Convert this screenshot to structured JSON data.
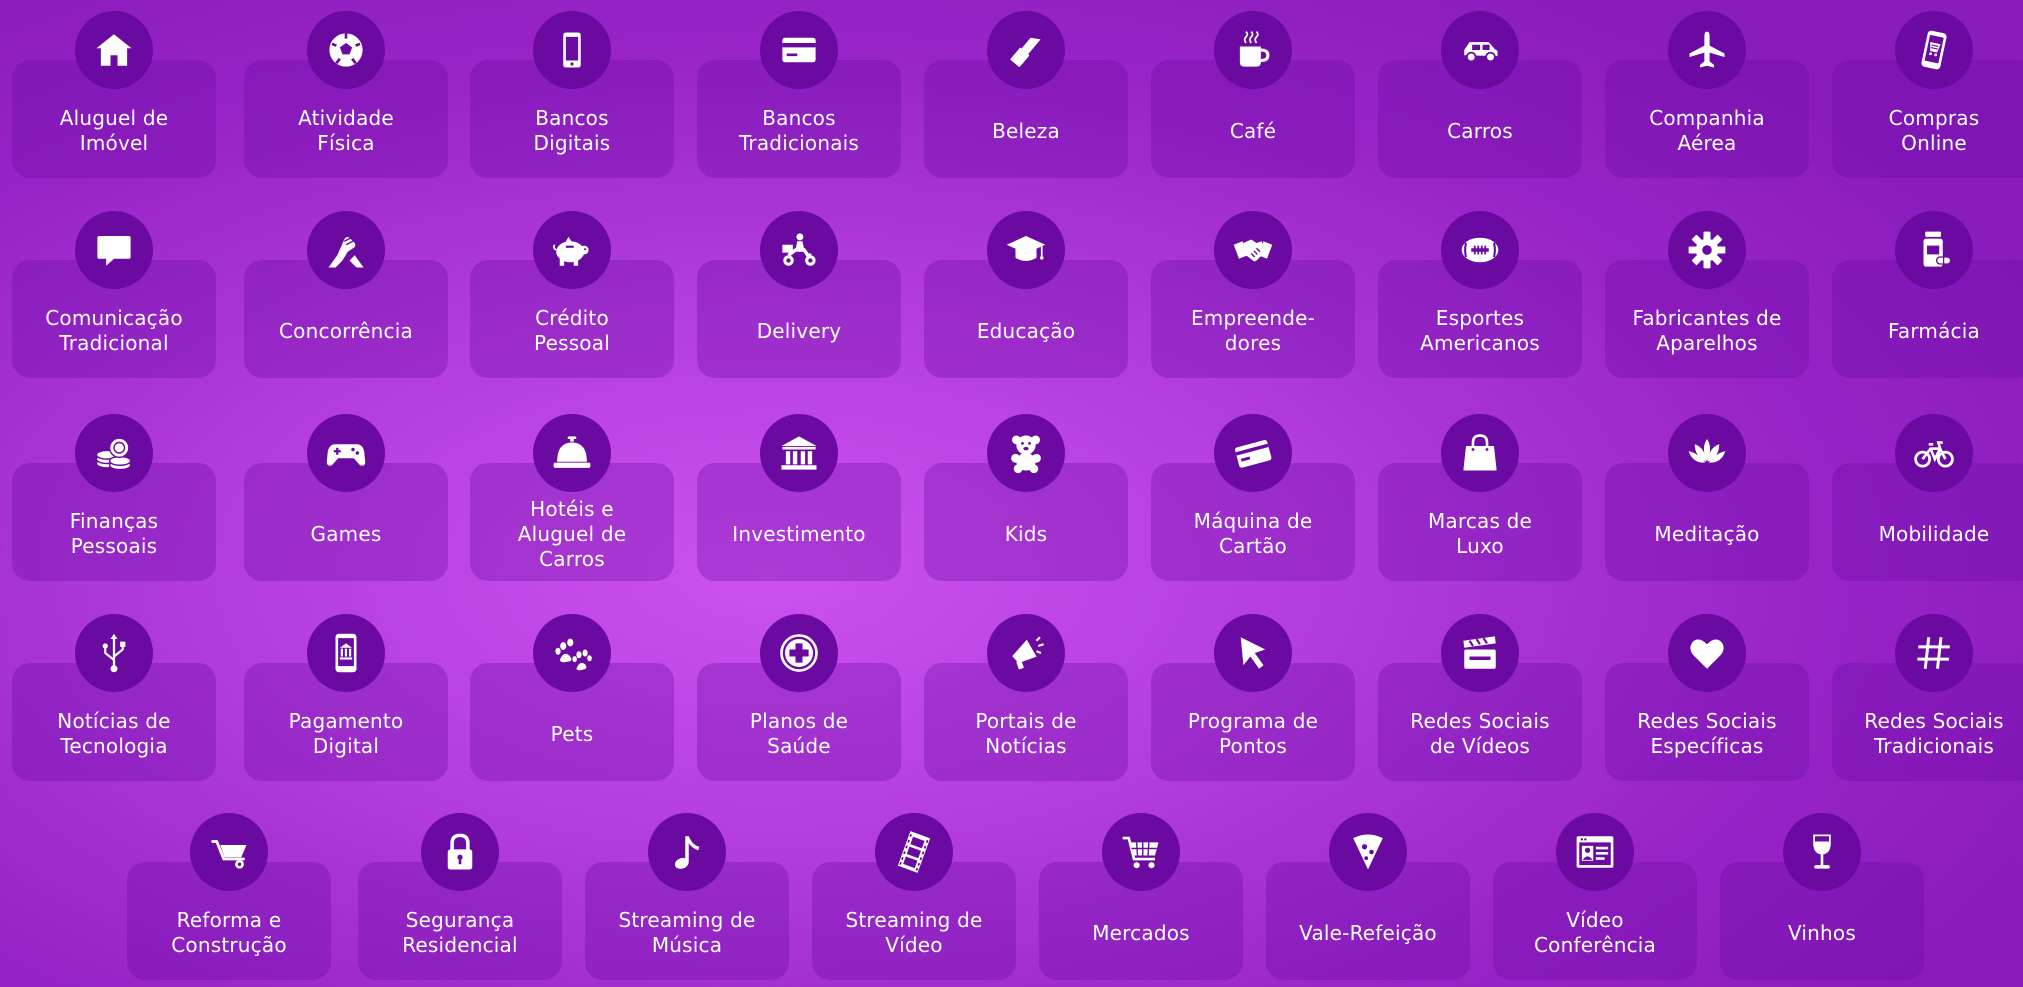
{
  "background": {
    "colors": [
      "#cc52ee",
      "#9824c8"
    ]
  },
  "colors": {
    "card": "#7a0fb2",
    "icon_circle": "#6a0aa0",
    "text": "#ffffff"
  },
  "rows": [
    {
      "items": [
        {
          "label": "Aluguel de\nImóvel",
          "icon": "home-icon"
        },
        {
          "label": "Atividade\nFísica",
          "icon": "soccer-ball-icon"
        },
        {
          "label": "Bancos\nDigitais",
          "icon": "smartphone-icon"
        },
        {
          "label": "Bancos\nTradicionais",
          "icon": "credit-card-icon"
        },
        {
          "label": "Beleza",
          "icon": "lipstick-icon"
        },
        {
          "label": "Café",
          "icon": "coffee-cup-icon"
        },
        {
          "label": "Carros",
          "icon": "car-icon"
        },
        {
          "label": "Companhia\nAérea",
          "icon": "airplane-icon"
        },
        {
          "label": "Compras\nOnline",
          "icon": "shopping-phone-icon"
        }
      ]
    },
    {
      "items": [
        {
          "label": "Comunicação\nTradicional",
          "icon": "chat-bubble-icon"
        },
        {
          "label": "Concorrência",
          "icon": "arm-wrestling-icon"
        },
        {
          "label": "Crédito\nPessoal",
          "icon": "piggy-bank-icon"
        },
        {
          "label": "Delivery",
          "icon": "delivery-scooter-icon"
        },
        {
          "label": "Educação",
          "icon": "graduation-cap-icon"
        },
        {
          "label": "Empreende-\ndores",
          "icon": "handshake-icon"
        },
        {
          "label": "Esportes\nAmericanos",
          "icon": "football-icon"
        },
        {
          "label": "Fabricantes de\nAparelhos",
          "icon": "gear-icon"
        },
        {
          "label": "Farmácia",
          "icon": "medicine-bottle-icon"
        }
      ]
    },
    {
      "items": [
        {
          "label": "Finanças\nPessoais",
          "icon": "coins-icon"
        },
        {
          "label": "Games",
          "icon": "gamepad-icon"
        },
        {
          "label": "Hotéis e\nAluguel de\nCarros",
          "icon": "service-bell-icon"
        },
        {
          "label": "Investimento",
          "icon": "bank-building-icon"
        },
        {
          "label": "Kids",
          "icon": "teddy-bear-icon"
        },
        {
          "label": "Máquina de\nCartão",
          "icon": "card-machine-icon"
        },
        {
          "label": "Marcas de\nLuxo",
          "icon": "shopping-bag-icon"
        },
        {
          "label": "Meditação",
          "icon": "lotus-icon"
        },
        {
          "label": "Mobilidade",
          "icon": "bicycle-icon"
        }
      ]
    },
    {
      "items": [
        {
          "label": "Notícias de\nTecnologia",
          "icon": "usb-icon"
        },
        {
          "label": "Pagamento\nDigital",
          "icon": "mobile-bank-icon"
        },
        {
          "label": "Pets",
          "icon": "paw-icon"
        },
        {
          "label": "Planos de\nSaúde",
          "icon": "medical-cross-icon"
        },
        {
          "label": "Portais de\nNotícias",
          "icon": "megaphone-icon"
        },
        {
          "label": "Programa de\nPontos",
          "icon": "cursor-icon"
        },
        {
          "label": "Redes Sociais\nde Vídeos",
          "icon": "clapperboard-icon"
        },
        {
          "label": "Redes Sociais\nEspecíficas",
          "icon": "heart-icon"
        },
        {
          "label": "Redes Sociais\nTradicionais",
          "icon": "hashtag-icon"
        }
      ]
    },
    {
      "items": [
        {
          "label": "Reforma e\nConstrução",
          "icon": "wheelbarrow-icon"
        },
        {
          "label": "Segurança\nResidencial",
          "icon": "padlock-icon"
        },
        {
          "label": "Streaming de\nMúsica",
          "icon": "music-note-icon"
        },
        {
          "label": "Streaming de\nVídeo",
          "icon": "film-strip-icon"
        },
        {
          "label": "Mercados",
          "icon": "shopping-cart-icon"
        },
        {
          "label": "Vale-Refeição",
          "icon": "pizza-slice-icon"
        },
        {
          "label": "Vídeo\nConferência",
          "icon": "video-call-icon"
        },
        {
          "label": "Vinhos",
          "icon": "wine-glass-icon"
        }
      ]
    }
  ]
}
